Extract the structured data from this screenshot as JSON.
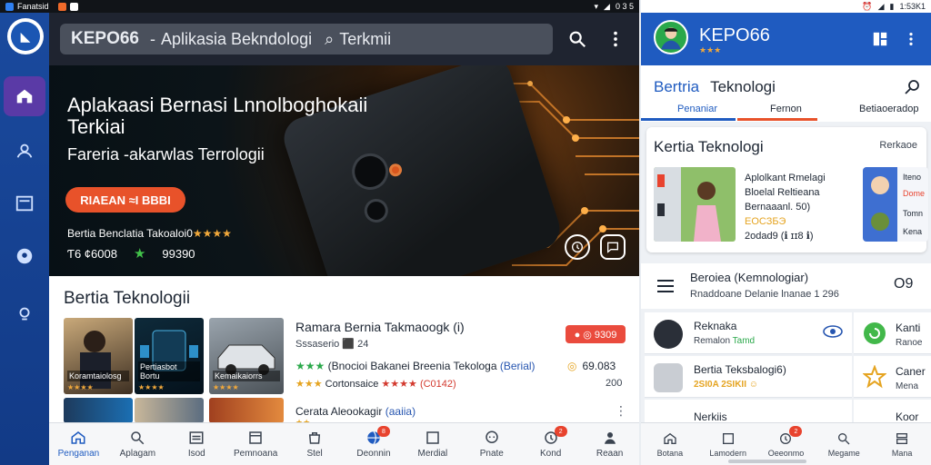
{
  "left_status": {
    "app_label": "Fanatsid",
    "right": "0 3 5"
  },
  "left": {
    "search": {
      "brand": "KEPO66",
      "text": "Aplikasia Bekndologi",
      "query": "Terkmii"
    },
    "rail": [
      "home",
      "profile",
      "news",
      "location",
      "settings"
    ],
    "hero": {
      "title": "Aplakaasi Bernasi Lnnolboghokaii Terkiai",
      "subtitle": "Fareria -akarwlas Terrologii",
      "cta": "RIAEAN ≈I BBBI",
      "meta": "Bertia Benclatia Takoaloi0",
      "stars": "★★★★",
      "stat1": "Ƭ6 ¢6008",
      "stat2": "99390"
    },
    "section_title": "Bertia Teknologii",
    "thumbs": [
      {
        "cap": "Koramtaiolosg",
        "sub": "★★★★"
      },
      {
        "cap": "Pertiasbot Bortu",
        "sub": "★★★★"
      },
      {
        "cap": "Kemaikaiorrs",
        "sub": "★★★★"
      }
    ],
    "news": {
      "title": "Ramara Bernia Takmaoogk (i)",
      "meta": "Sssaserio ⬛ 24",
      "badge": "● ◎ 9309",
      "line2_stars": "★★★",
      "line2_text": "(Bnocioi Bakanei Breenia Tekologa",
      "line2_tag": "(Berial)",
      "line3_stars": "★★★",
      "line3_text": "Cortonsaice",
      "line3_red": "★★★★",
      "line3_end": "(C0142)",
      "price": "69.083",
      "price2": "200",
      "line4": "Cerata Aleookagir",
      "line4_tag": "(aaiia)",
      "line4_sub": "★★"
    },
    "bottom_nav": [
      {
        "label": "Penganan",
        "icon": "home-icon",
        "active": true
      },
      {
        "label": "Aplagam",
        "icon": "search-icon"
      },
      {
        "label": "Isod",
        "icon": "list-icon"
      },
      {
        "label": "Pemnoana",
        "icon": "book-icon"
      },
      {
        "label": "Stel",
        "icon": "bag-icon"
      },
      {
        "label": "Deonnin",
        "icon": "globe-icon",
        "badge": "8"
      },
      {
        "label": "Merdial",
        "icon": "square-icon"
      },
      {
        "label": "Pnate",
        "icon": "chat-icon"
      },
      {
        "label": "Kond",
        "icon": "clock-icon",
        "badge": "2"
      },
      {
        "label": "Reaan",
        "icon": "user-icon"
      }
    ]
  },
  "right": {
    "status": "1:53K1",
    "title": "KEPO66",
    "stars": "★★★",
    "tab_a": "Bertria",
    "tab_b": "Teknologi",
    "subtabs": [
      "Penaniar",
      "Fernon",
      "Betiaoeradop"
    ],
    "card": {
      "title": "Kertia Teknologi",
      "more": "Rerkaoe",
      "line1": "Aplolkant Rmelagi",
      "line2": "Bloelal Reltieana",
      "line3": "Bernaaanl. 50)",
      "line4": "ЕОСЗБЭ",
      "line5": "2odad9 (ℹ ɪɪ8 ℹ)",
      "mini": [
        "Iteno",
        "Dome",
        "Tomn",
        "Kena"
      ]
    },
    "list_head": {
      "t1": "Beroiea (Kemnologiar)",
      "t2": "Rnaddoane Delanie lnanae 1 296",
      "icon": "O9"
    },
    "rows": [
      {
        "n1": "Reknaka",
        "n2a": "Remalon",
        "n2b": "Tamd"
      },
      {
        "n1": "Bertia Teksbalogi6)",
        "n2a": "2SI0A 2SIKII",
        "n2b": "☺"
      },
      {
        "n1": "Nerkiis",
        "n2a": "",
        "n2b": ""
      }
    ],
    "cols": [
      {
        "n1": "Kanti",
        "n2": "Ranoe"
      },
      {
        "n1": "Caner",
        "n2": "Mena"
      },
      {
        "n1": "Koor",
        "n2": ""
      }
    ],
    "bottom_nav": [
      {
        "label": "Botana",
        "icon": "home-icon"
      },
      {
        "label": "Lamodern",
        "icon": "square-icon"
      },
      {
        "label": "Oeeonmo",
        "icon": "clock-icon",
        "badge": "2"
      },
      {
        "label": "Megame",
        "icon": "search-icon"
      },
      {
        "label": "Mana",
        "icon": "stack-icon"
      }
    ]
  }
}
